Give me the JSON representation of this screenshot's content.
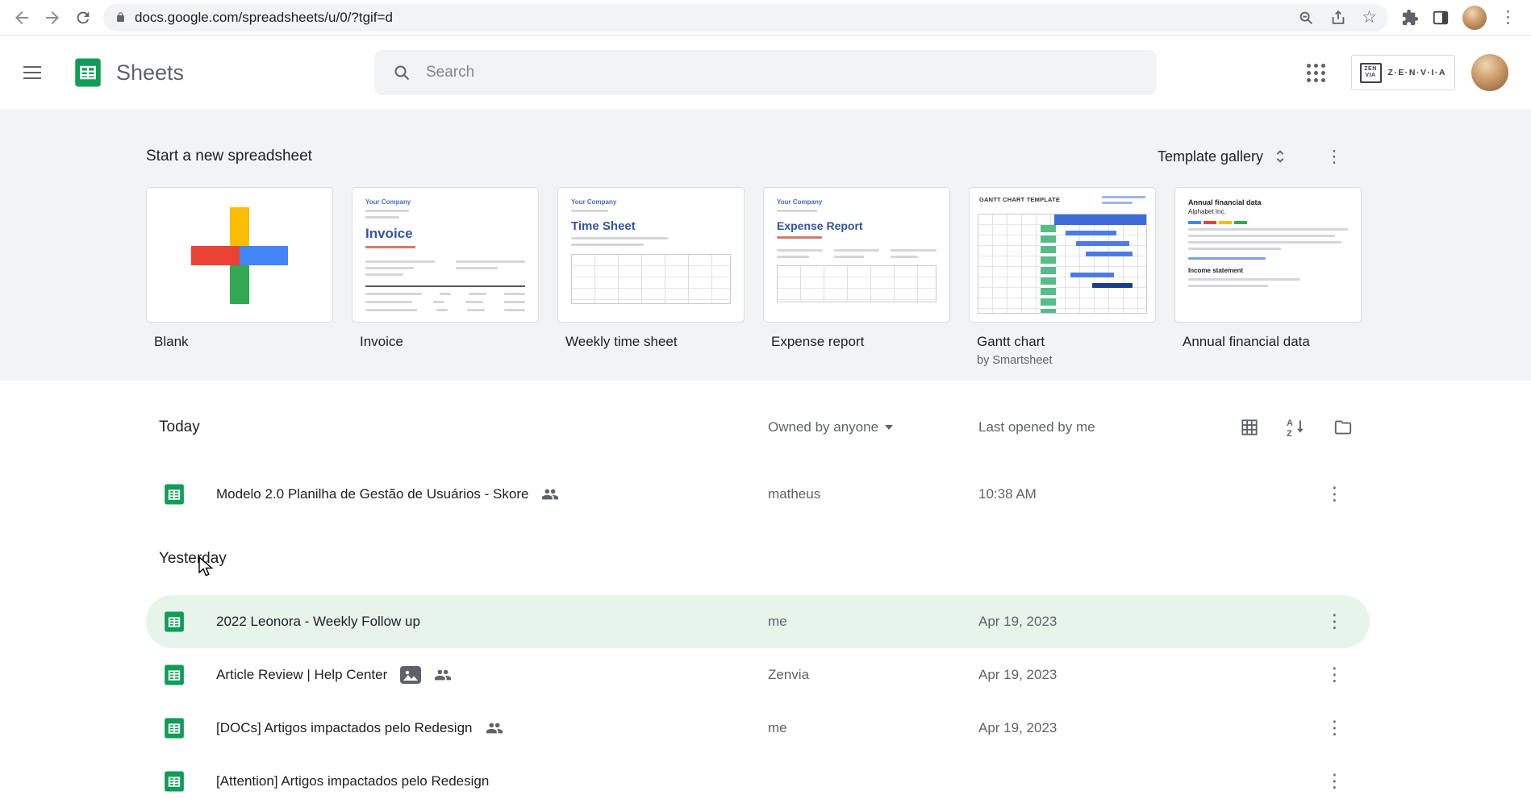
{
  "browser": {
    "url": "docs.google.com/spreadsheets/u/0/?tgif=d"
  },
  "header": {
    "app_name": "Sheets",
    "search_placeholder": "Search",
    "workspace_badge_text": "Z·E·N·V·I·A",
    "workspace_mark_line1": "ZEN",
    "workspace_mark_line2": "VIA"
  },
  "templates": {
    "section_title": "Start a new spreadsheet",
    "gallery_label": "Template gallery",
    "cards": [
      {
        "label": "Blank",
        "sublabel": ""
      },
      {
        "label": "Invoice",
        "sublabel": ""
      },
      {
        "label": "Weekly time sheet",
        "sublabel": ""
      },
      {
        "label": "Expense report",
        "sublabel": ""
      },
      {
        "label": "Gantt chart",
        "sublabel": "by Smartsheet"
      },
      {
        "label": "Annual financial data",
        "sublabel": ""
      }
    ],
    "thumbs": {
      "company": "Your Company",
      "invoice_title": "Invoice",
      "timesheet_title": "Time Sheet",
      "expense_title": "Expense Report",
      "gantt_title": "GANTT CHART TEMPLATE",
      "annual_title": "Annual financial data",
      "annual_subtitle": "Alphabet Inc.",
      "annual_section": "Income statement"
    }
  },
  "filelist": {
    "columns": {
      "owner": "Owned by anyone",
      "last_opened": "Last opened by me"
    },
    "groups": [
      {
        "label": "Today",
        "rows": [
          {
            "title": "Modelo 2.0 Planilha de Gestão de Usuários - Skore",
            "owner": "matheus",
            "opened": "10:38 AM"
          }
        ]
      },
      {
        "label": "Yesterday",
        "rows": [
          {
            "title": "2022 Leonora - Weekly Follow up",
            "owner": "me",
            "opened": "Apr 19, 2023"
          },
          {
            "title": "Article Review | Help Center",
            "owner": "Zenvia",
            "opened": "Apr 19, 2023"
          },
          {
            "title": "[DOCs] Artigos impactados pelo Redesign",
            "owner": "me",
            "opened": "Apr 19, 2023"
          },
          {
            "title": "[Attention] Artigos impactados pelo Redesign",
            "owner": "",
            "opened": ""
          }
        ]
      }
    ]
  },
  "colors": {
    "sheets_green": "#0F9D58",
    "row_highlight": "#E6F4EA",
    "accent_blue": "#4285F4"
  }
}
